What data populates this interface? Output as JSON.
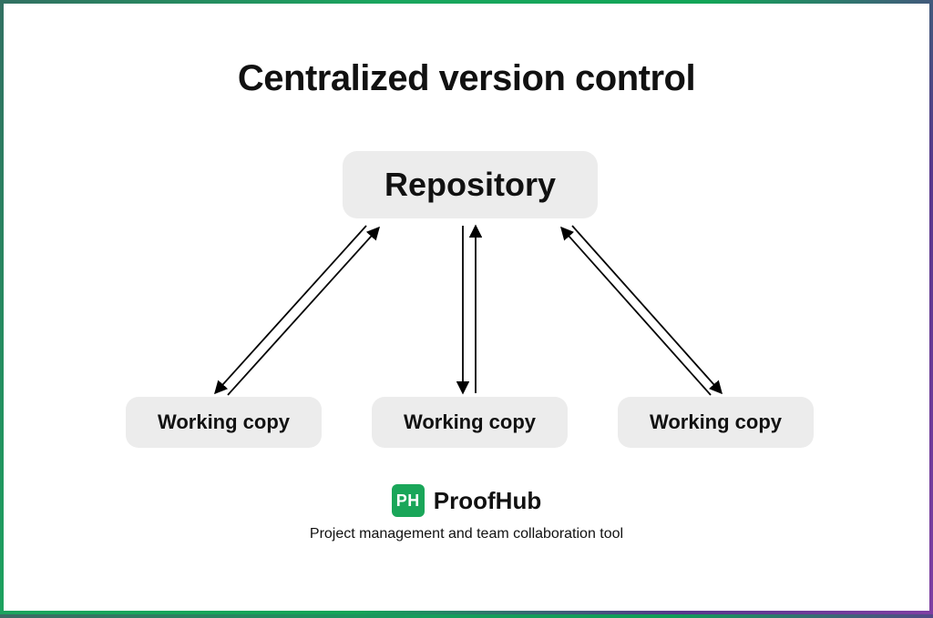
{
  "title": "Centralized version control",
  "nodes": {
    "repository": "Repository",
    "working_copy_1": "Working copy",
    "working_copy_2": "Working copy",
    "working_copy_3": "Working copy"
  },
  "branding": {
    "logo_text": "PH",
    "name": "ProofHub",
    "tagline": "Project management and team collaboration tool"
  },
  "colors": {
    "node_bg": "#ececec",
    "logo_bg": "#1aa659",
    "text": "#111111"
  }
}
